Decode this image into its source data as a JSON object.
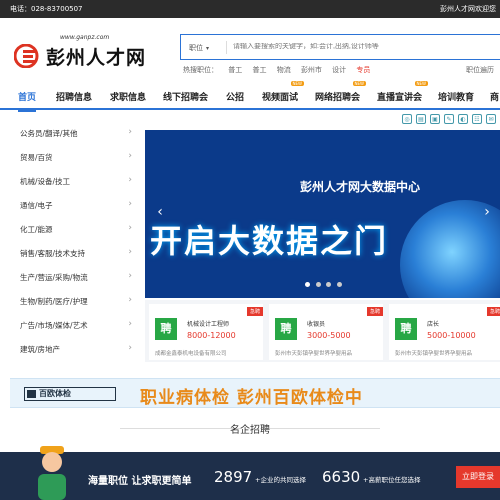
{
  "topbar": {
    "phone": "电话：028-83700507",
    "welcome": "彭州人才网欢迎您"
  },
  "logo": {
    "url": "www.ganpz.com",
    "name": "彭州人才网"
  },
  "search": {
    "type": "职位",
    "placeholder": "请输入要搜索的关键字，如:会计,出纳,设计师等"
  },
  "hot": {
    "label": "热搜职位：",
    "items": [
      "普工",
      "普工",
      "物流",
      "彭州市",
      "设计",
      "专员"
    ]
  },
  "location": "职位遍历",
  "nav": [
    {
      "label": "首页"
    },
    {
      "label": "招聘信息"
    },
    {
      "label": "求职信息"
    },
    {
      "label": "线下招聘会"
    },
    {
      "label": "公招"
    },
    {
      "label": "视频面试",
      "badge": "NEW"
    },
    {
      "label": "网络招聘会",
      "badge": "NEW"
    },
    {
      "label": "直播宣讲会",
      "badge": "NEW"
    },
    {
      "label": "培训教育"
    },
    {
      "label": "商"
    }
  ],
  "categories": [
    "公务员/翻译/其他",
    "贸易/百货",
    "机械/设备/技工",
    "通信/电子",
    "化工/能源",
    "销售/客服/技术支持",
    "生产/营运/采购/物流",
    "生物/制药/医疗/护理",
    "广告/市场/媒体/艺术",
    "建筑/房地产"
  ],
  "banner": {
    "subtitle": "彭州人才网大数据中心",
    "headline": "开启大数据之门"
  },
  "cards": [
    {
      "icon_text": "聘",
      "title": "机械设计工程师",
      "salary": "8000-12000",
      "company": "成都金鑫泰机电设备有限公司",
      "tag": "急聘"
    },
    {
      "icon_text": "聘",
      "title": "收银员",
      "salary": "3000-5000",
      "company": "彭州市天彭镇孕婴世界孕婴用品",
      "tag": "急聘"
    },
    {
      "icon_text": "聘",
      "title": "店长",
      "salary": "5000-10000",
      "company": "彭州市天彭镇孕婴世界孕婴用品",
      "tag": "急聘"
    }
  ],
  "ad": {
    "logo_text": "百欧体检",
    "text": "职业病体检  彭州百欧体检中"
  },
  "section_title": "名企招聘",
  "bottom": {
    "slogan": "海量职位 让求职更简单",
    "num1": "2897",
    "label1": "+企业的共同选择",
    "num2": "6630",
    "label2": "+高薪职位任您选择",
    "button": "立即登录"
  },
  "colors": {
    "accent": "#2b73d6",
    "red": "#e5382c",
    "green": "#28a745",
    "dark": "#2b2b2b",
    "navy": "#1e2f4a"
  }
}
